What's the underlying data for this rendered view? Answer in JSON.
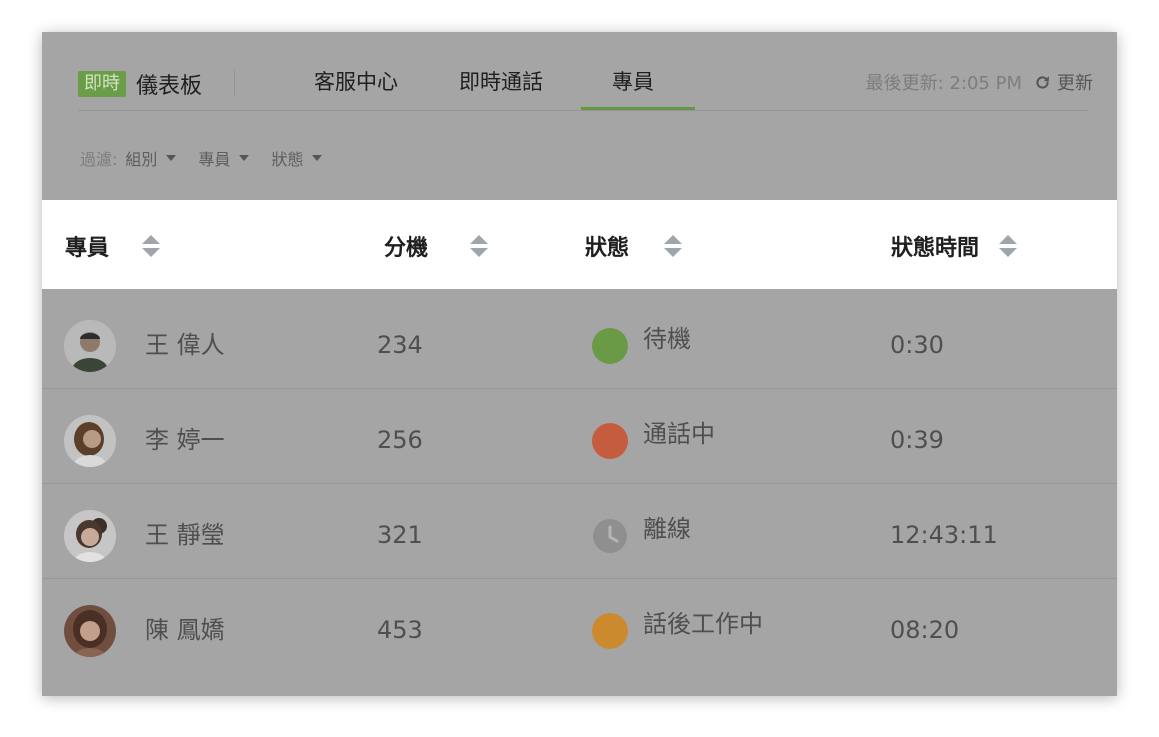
{
  "header": {
    "badge": "即時",
    "title": "儀表板",
    "tabs": [
      {
        "label": "客服中心"
      },
      {
        "label": "即時通話"
      },
      {
        "label": "專員"
      }
    ],
    "active_tab": "專員",
    "last_updated": "最後更新: 2:05 PM",
    "refresh_label": "更新"
  },
  "filters": {
    "label": "過濾:",
    "items": [
      {
        "label": "組別"
      },
      {
        "label": "專員"
      },
      {
        "label": "狀態"
      }
    ]
  },
  "table": {
    "columns": [
      "專員",
      "分機",
      "狀態",
      "狀態時間"
    ],
    "rows": [
      {
        "name": "王 偉人",
        "extension": "234",
        "status": "待機",
        "status_color": "#6b9a46",
        "status_time": "0:30",
        "status_icon": "dot"
      },
      {
        "name": "李 婷一",
        "extension": "256",
        "status": "通話中",
        "status_color": "#c65c3e",
        "status_time": "0:39",
        "status_icon": "dot"
      },
      {
        "name": "王 靜瑩",
        "extension": "321",
        "status": "離線",
        "status_color": "#8f8f8f",
        "status_time": "12:43:11",
        "status_icon": "clock"
      },
      {
        "name": "陳 鳳嬌",
        "extension": "453",
        "status": "話後工作中",
        "status_color": "#cc8a2e",
        "status_time": "08:20",
        "status_icon": "dot"
      }
    ]
  },
  "colors": {
    "accent": "#5f9a43",
    "overlay": "#a5a5a5"
  }
}
